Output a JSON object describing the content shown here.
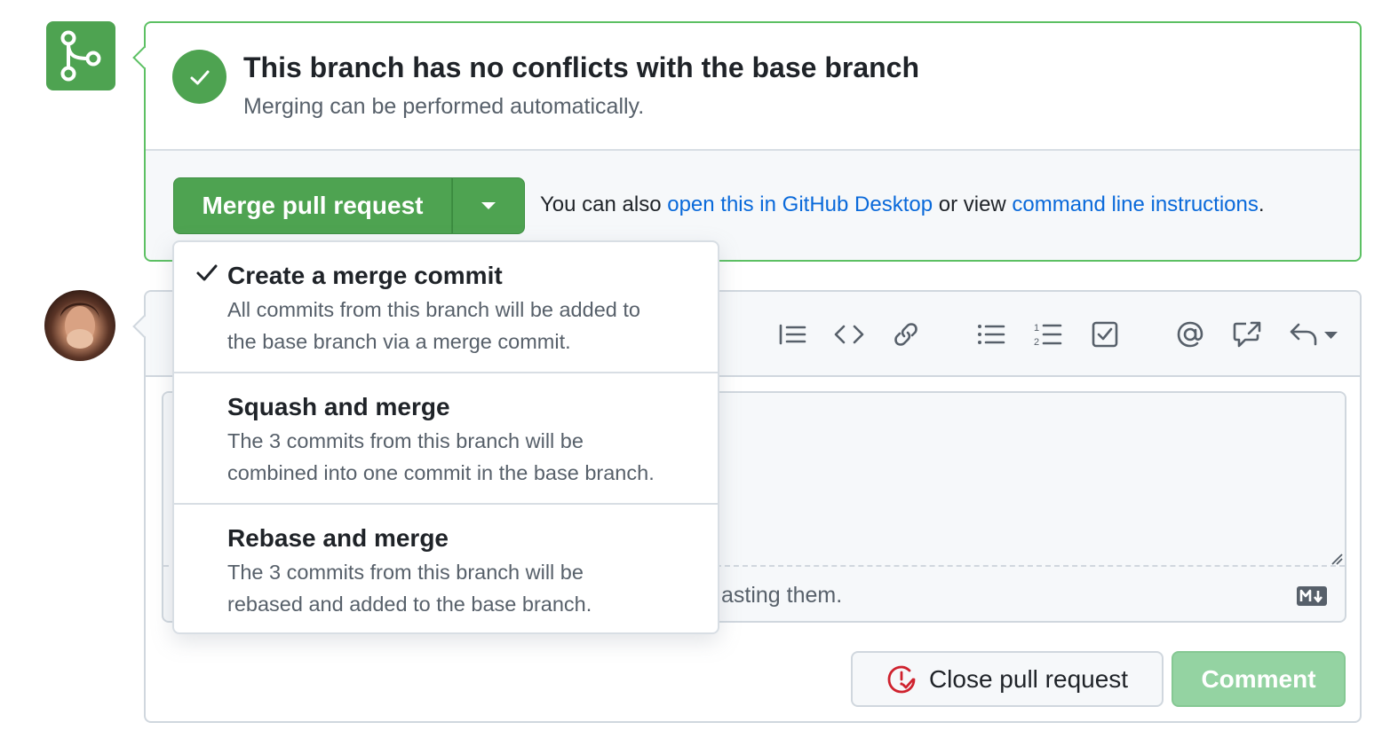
{
  "merge_status": {
    "title": "This branch has no conflicts with the base branch",
    "subtitle": "Merging can be performed automatically.",
    "icon": "git-merge-icon",
    "status_icon": "check-circle-icon",
    "accent": "#4ea351"
  },
  "merge_actions": {
    "merge_button_label": "Merge pull request",
    "caret_icon": "triangle-down-icon",
    "also_prefix": "You can also ",
    "desktop_link": "open this in GitHub Desktop",
    "also_middle": " or view ",
    "cli_link": "command line instructions",
    "also_suffix": "."
  },
  "merge_menu": {
    "items": [
      {
        "title": "Create a merge commit",
        "desc_line1": "All commits from this branch will be added to",
        "desc_line2": "the base branch via a merge commit.",
        "selected": true
      },
      {
        "title": "Squash and merge",
        "desc_line1": "The 3 commits from this branch will be",
        "desc_line2": "combined into one commit in the base branch.",
        "selected": false
      },
      {
        "title": "Rebase and merge",
        "desc_line1": "The 3 commits from this branch will be",
        "desc_line2": "rebased and added to the base branch.",
        "selected": false
      }
    ]
  },
  "comment": {
    "toolbar_icons": [
      "quote-icon",
      "code-icon",
      "link-icon",
      "unordered-list-icon",
      "ordered-list-icon",
      "tasklist-icon",
      "mention-icon",
      "cross-reference-icon",
      "reply-icon"
    ],
    "attach_hint": "asting them.",
    "markdown_icon": "markdown-icon",
    "close_button_label": "Close pull request",
    "comment_button_label": "Comment"
  }
}
